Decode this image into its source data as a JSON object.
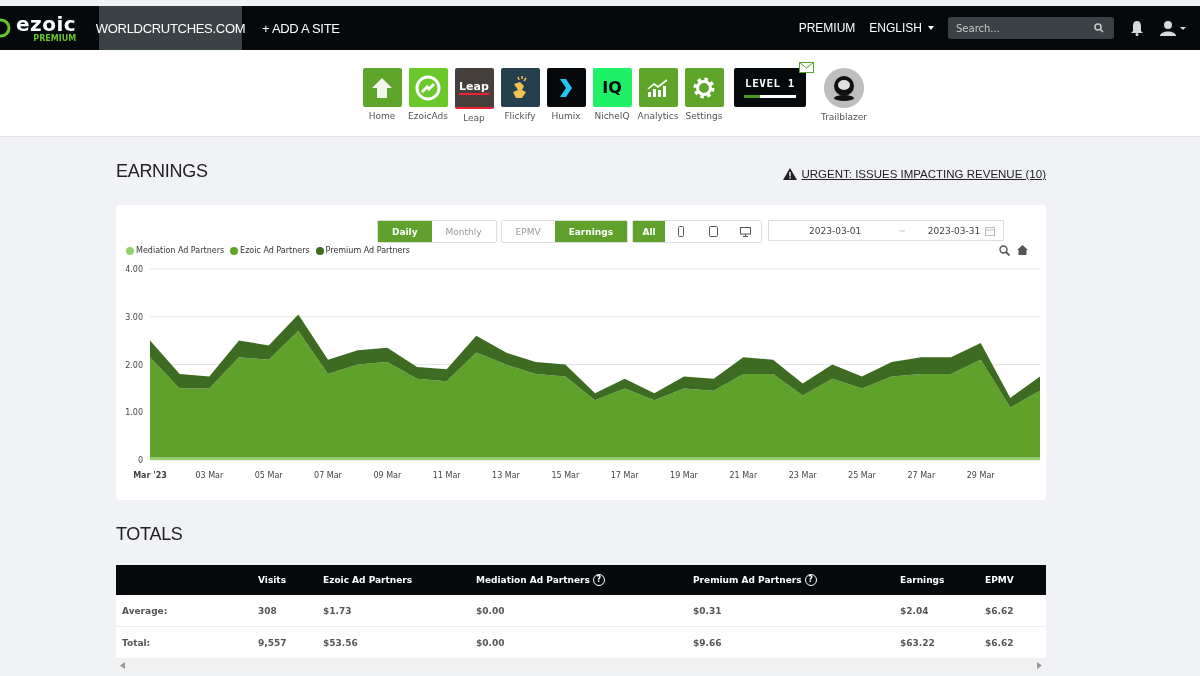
{
  "nav": {
    "logo": "ezoic",
    "logo_sub": "PREMIUM",
    "sites": [
      {
        "label": "WORLDCRUTCHES.COM",
        "selected": true
      },
      {
        "label": "+ ADD A SITE",
        "selected": false
      }
    ],
    "links": [
      {
        "label": "PREMIUM",
        "dropdown": false
      },
      {
        "label": "ENGLISH",
        "dropdown": true
      }
    ],
    "search": {
      "placeholder": "Search..."
    }
  },
  "apps": [
    {
      "kind": "home",
      "label": "Home"
    },
    {
      "kind": "ezoicads",
      "label": "EzoicAds"
    },
    {
      "kind": "leap",
      "label": "Leap",
      "logo_text": "Leap"
    },
    {
      "kind": "flickify",
      "label": "Flickify"
    },
    {
      "kind": "humix",
      "label": "Humix"
    },
    {
      "kind": "nicheiq",
      "label": "NicheIQ",
      "logo_text": "IQ"
    },
    {
      "kind": "analytics",
      "label": "Analytics"
    },
    {
      "kind": "settings",
      "label": "Settings"
    }
  ],
  "level_badge": {
    "text": "LEVEL 1",
    "level": 0.3,
    "unread_mail": true
  },
  "rank": {
    "label": "Trailblazer"
  },
  "earnings": {
    "title": "EARNINGS",
    "alert": "URGENT: ISSUES IMPACTING REVENUE (10)",
    "period": [
      {
        "label": "Daily",
        "selected": true
      },
      {
        "label": "Monthly",
        "selected": false
      }
    ],
    "metric": [
      {
        "label": "EPMV",
        "selected": false
      },
      {
        "label": "Earnings",
        "selected": true
      }
    ],
    "device": [
      {
        "kind": "text",
        "label": "All",
        "selected": true
      },
      {
        "kind": "phone",
        "selected": false
      },
      {
        "kind": "tablet",
        "selected": false
      },
      {
        "kind": "desktop",
        "selected": false
      }
    ],
    "date_from": "2023-03-01",
    "date_sep": "~",
    "date_to": "2023-03-31",
    "chart_data": {
      "type": "area",
      "stacked": true,
      "categories": [
        "Mar '23",
        null,
        "03 Mar",
        null,
        "05 Mar",
        null,
        "07 Mar",
        null,
        "09 Mar",
        null,
        "11 Mar",
        null,
        "13 Mar",
        null,
        "15 Mar",
        null,
        "17 Mar",
        null,
        "19 Mar",
        null,
        "21 Mar",
        null,
        "23 Mar",
        null,
        "25 Mar",
        null,
        "27 Mar",
        null,
        "29 Mar",
        null,
        null
      ],
      "series": [
        {
          "name": "Mediation Ad Partners",
          "color": "#8fd16a",
          "values": [
            0.05,
            0.05,
            0.05,
            0.05,
            0.05,
            0.05,
            0.05,
            0.05,
            0.05,
            0.05,
            0.05,
            0.05,
            0.05,
            0.05,
            0.05,
            0.05,
            0.05,
            0.05,
            0.05,
            0.05,
            0.05,
            0.05,
            0.05,
            0.05,
            0.05,
            0.05,
            0.05,
            0.05,
            0.05,
            0.05,
            0.05
          ]
        },
        {
          "name": "Ezoic Ad Partners",
          "color": "#5fa12a",
          "values": [
            2.1,
            1.45,
            1.45,
            2.1,
            2.05,
            2.65,
            1.75,
            1.95,
            2.0,
            1.65,
            1.6,
            2.2,
            1.95,
            1.75,
            1.7,
            1.2,
            1.45,
            1.2,
            1.45,
            1.4,
            1.75,
            1.75,
            1.3,
            1.65,
            1.45,
            1.7,
            1.75,
            1.75,
            2.05,
            1.05,
            1.4
          ]
        },
        {
          "name": "Premium Ad Partners",
          "color": "#3e6b22",
          "values": [
            0.35,
            0.3,
            0.25,
            0.35,
            0.3,
            0.35,
            0.3,
            0.3,
            0.3,
            0.25,
            0.25,
            0.35,
            0.25,
            0.25,
            0.25,
            0.15,
            0.2,
            0.15,
            0.25,
            0.25,
            0.35,
            0.3,
            0.25,
            0.3,
            0.25,
            0.3,
            0.35,
            0.35,
            0.35,
            0.2,
            0.3
          ]
        }
      ],
      "ylim": [
        0,
        4
      ],
      "yticks": [
        0,
        {
          "value": 1,
          "label": "1.00"
        },
        {
          "value": 2,
          "label": "2.00"
        },
        {
          "value": 3,
          "label": "3.00"
        },
        {
          "value": 4,
          "label": "4.00"
        }
      ]
    }
  },
  "totals": {
    "title": "TOTALS",
    "columns": [
      {
        "label": "Visits"
      },
      {
        "label": "Ezoic Ad Partners"
      },
      {
        "label": "Mediation Ad Partners",
        "help": "?"
      },
      {
        "label": "Premium Ad Partners",
        "help": "?"
      },
      {
        "label": "Earnings"
      },
      {
        "label": "EPMV"
      }
    ],
    "rows": [
      {
        "label": "Average:",
        "cells": [
          "308",
          "$1.73",
          "$0.00",
          "$0.31",
          "$2.04",
          "$6.62"
        ]
      },
      {
        "label": "Total:",
        "cells": [
          "9,557",
          "$53.56",
          "$0.00",
          "$9.66",
          "$63.22",
          "$6.62"
        ]
      }
    ]
  }
}
